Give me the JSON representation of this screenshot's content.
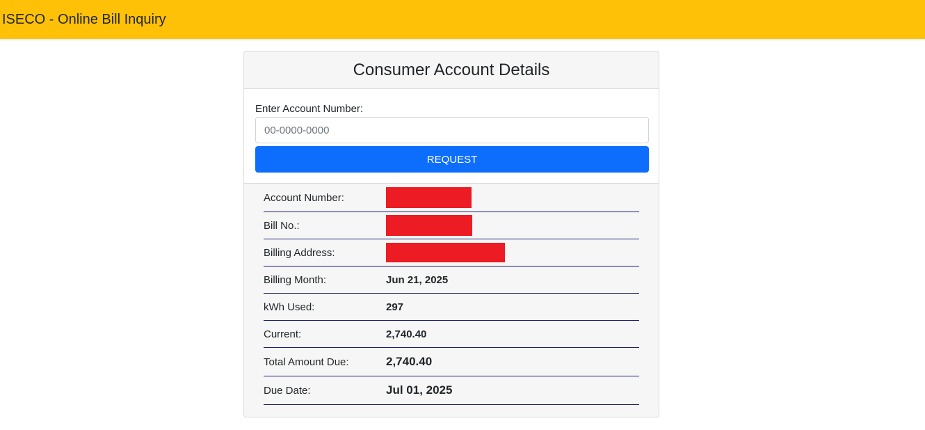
{
  "app": {
    "title": "ISECO - Online Bill Inquiry"
  },
  "card": {
    "title": "Consumer Account Details"
  },
  "form": {
    "label": "Enter Account Number:",
    "placeholder": "00-0000-0000",
    "value": "",
    "button_label": "REQUEST"
  },
  "details": {
    "account_number_label": "Account Number:",
    "bill_no_label": "Bill No.:",
    "billing_address_label": "Billing Address:",
    "billing_month_label": "Billing Month:",
    "billing_month_value": "Jun 21, 2025",
    "kwh_label": "kWh Used:",
    "kwh_value": "297",
    "current_label": "Current:",
    "current_value": "2,740.40",
    "total_label": "Total Amount Due:",
    "total_value": "2,740.40",
    "due_label": "Due Date:",
    "due_value": "Jul 01, 2025"
  },
  "colors": {
    "header_bg": "#ffc107",
    "button_bg": "#0d6efd",
    "redaction": "#ed1c24",
    "row_border": "#1a1a6e"
  }
}
